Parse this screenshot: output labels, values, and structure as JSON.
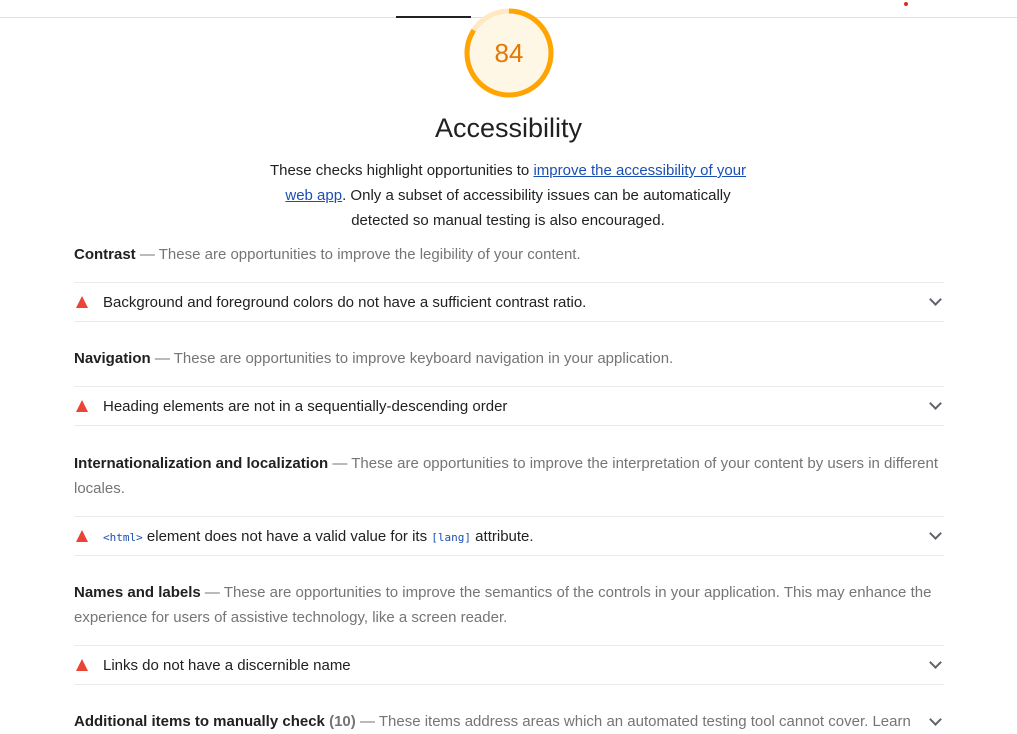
{
  "score": {
    "value": "84",
    "fraction": 0.84,
    "color": "#ffa400"
  },
  "category": {
    "title": "Accessibility",
    "description_pre": "These checks highlight opportunities to ",
    "description_link": "improve the accessibility of your web app",
    "description_post": ". Only a subset of accessibility issues can be automatically detected so manual testing is also encouraged."
  },
  "groups": {
    "contrast": {
      "title": "Contrast",
      "dash": "—",
      "description": "These are opportunities to improve the legibility of your content.",
      "audits": [
        {
          "title": "Background and foreground colors do not have a sufficient contrast ratio."
        }
      ]
    },
    "navigation": {
      "title": "Navigation",
      "dash": "—",
      "description": "These are opportunities to improve keyboard navigation in your application.",
      "audits": [
        {
          "title": "Heading elements are not in a sequentially-descending order"
        }
      ]
    },
    "i18n": {
      "title": "Internationalization and localization",
      "dash": "—",
      "description": "These are opportunities to improve the interpretation of your content by users in different locales.",
      "audits": [
        {
          "code1": "<html>",
          "text1": " element does not have a valid value for its ",
          "code2": "[lang]",
          "text2": " attribute."
        }
      ]
    },
    "names": {
      "title": "Names and labels",
      "dash": "—",
      "description": "These are opportunities to improve the semantics of the controls in your application. This may enhance the experience for users of assistive technology, like a screen reader.",
      "audits": [
        {
          "title": "Links do not have a discernible name"
        }
      ]
    },
    "manual": {
      "title": "Additional items to manually check",
      "count": "(10)",
      "dash": "—",
      "description": "These items address areas which an automated testing tool cannot cover. Learn"
    }
  },
  "colors": {
    "fail": "#eb4335",
    "link": "#1a4fb4",
    "gauge_ring": "#ffa400",
    "gauge_text": "#e67700"
  }
}
